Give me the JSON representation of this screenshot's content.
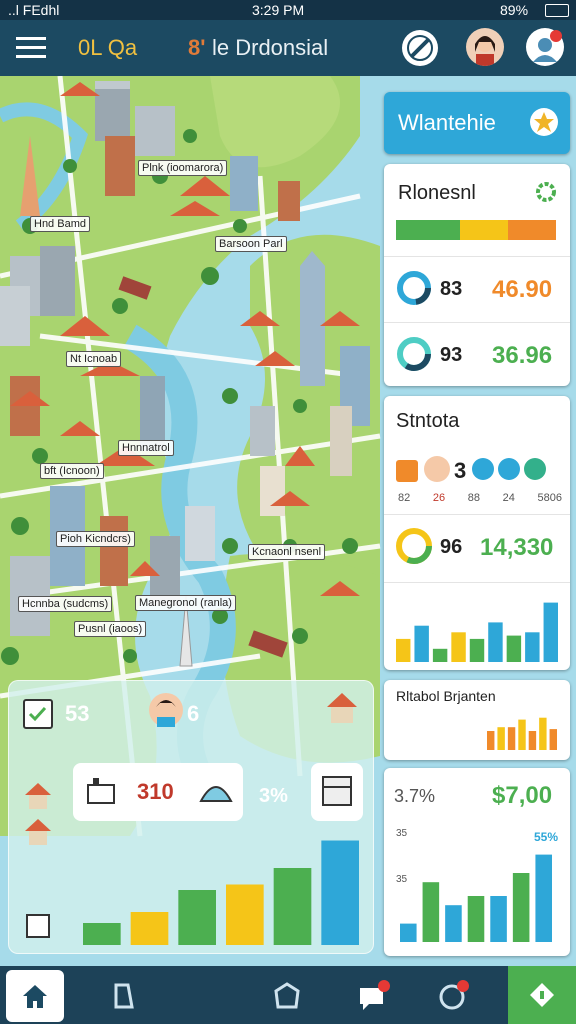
{
  "status_bar": {
    "carrier": "..l FEdhl",
    "time": "3:29 PM",
    "battery": "89%"
  },
  "header": {
    "left_title": "0L Qa",
    "center_title": "le Drdonsial",
    "center_icon": "8'"
  },
  "map_labels": [
    {
      "id": "l1",
      "text": "Plnk (ioomarora)"
    },
    {
      "id": "l2",
      "text": "Hnd Bamd"
    },
    {
      "id": "l3",
      "text": "Barsoon Parl"
    },
    {
      "id": "l4",
      "text": "Nt Icnoab"
    },
    {
      "id": "l5",
      "text": "Hnnnatrol"
    },
    {
      "id": "l6",
      "text": "bft (Icnoon)"
    },
    {
      "id": "l7",
      "text": "Pioh Kicndcrs)"
    },
    {
      "id": "l8",
      "text": "Kcnaonl nsenl"
    },
    {
      "id": "l9",
      "text": "Manegronol (ranla)"
    },
    {
      "id": "l10",
      "text": "Hcnnba (sudcms)"
    },
    {
      "id": "l11",
      "text": "Pusnl (iaoos)"
    }
  ],
  "panel": {
    "header_title": "Wlantehie",
    "header_icon_color": "#f0b428",
    "resources": {
      "title": "Rlonesnl",
      "bar_colors": [
        "#4caf50",
        "#f5c518",
        "#f08a2a"
      ],
      "row1": {
        "left": "83",
        "right": "46.90"
      },
      "row2": {
        "left": "93",
        "right": "36.96"
      }
    },
    "stats": {
      "title": "Stntota",
      "count": "3",
      "small_values": [
        "82",
        "26",
        "88",
        "24",
        "5806"
      ],
      "row_left": "96",
      "row_right": "14,330"
    },
    "bar_chart_a": [
      0.35,
      0.55,
      0.2,
      0.45,
      0.35,
      0.6,
      0.4,
      0.45,
      0.9
    ],
    "bar_chart_b": [
      0.5,
      0.6,
      0.6,
      0.8,
      0.5,
      0.85,
      0.55
    ],
    "revenue_title": "Rltabol Brjanten",
    "finance": {
      "left": "3.7%",
      "right": "$7,00",
      "pct": "55%",
      "axis_top": "35",
      "axis_mid": "35"
    },
    "bar_chart_c": [
      0.2,
      0.65,
      0.4,
      0.5,
      0.5,
      0.75,
      0.95
    ]
  },
  "bottom_panel": {
    "score": "53",
    "score2": "6",
    "mid_value": "310",
    "mid_value2": "3%",
    "bars": [
      0.2,
      0.3,
      0.5,
      0.55,
      0.7,
      0.95
    ]
  }
}
